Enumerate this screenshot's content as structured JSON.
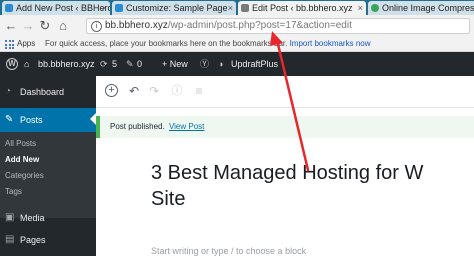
{
  "browser": {
    "tabs": [
      {
        "label": "Add New Post ‹ BBHero",
        "favicon_color": "#2b8bd0"
      },
      {
        "label": "Customize: Sample Page",
        "favicon_color": "#2b8bd0"
      },
      {
        "label": "Edit Post ‹ bb.bbhero.xyz",
        "favicon_color": "#7a7a7a"
      },
      {
        "label": "Online Image Compress",
        "favicon_color": "#3aa55a"
      }
    ],
    "address": {
      "domain": "bb.bbhero.xyz",
      "path": "/wp-admin/post.php?post=17&action=edit"
    },
    "bookmarks": {
      "apps_label": "Apps",
      "hint_text": "For quick access, place your bookmarks here on the bookmarks bar.",
      "hint_link": "Import bookmarks now"
    }
  },
  "adminbar": {
    "site_name": "bb.bbhero.xyz",
    "updates_count": "5",
    "comments_count": "0",
    "new_label": "+ New",
    "plugin_label": "UpdraftPlus"
  },
  "sidebar": {
    "items": [
      {
        "label": "Dashboard",
        "icon": "dashboard-icon"
      },
      {
        "label": "Posts",
        "icon": "pin-icon"
      },
      {
        "label": "Media",
        "icon": "media-icon"
      },
      {
        "label": "Pages",
        "icon": "pages-icon"
      }
    ],
    "posts_submenu": [
      "All Posts",
      "Add New",
      "Categories",
      "Tags"
    ]
  },
  "editor": {
    "notice_text": "Post published.",
    "notice_link": "View Post",
    "title_line1": "3 Best Managed Hosting for W",
    "title_line2": "Site",
    "block_placeholder": "Start writing or type / to choose a block"
  },
  "colors": {
    "tabbar_bg": "#1f6e8d",
    "admin_dark": "#23282d",
    "wp_blue": "#0073aa",
    "annotation_red": "#e8262b",
    "notice_green": "#46b450"
  }
}
